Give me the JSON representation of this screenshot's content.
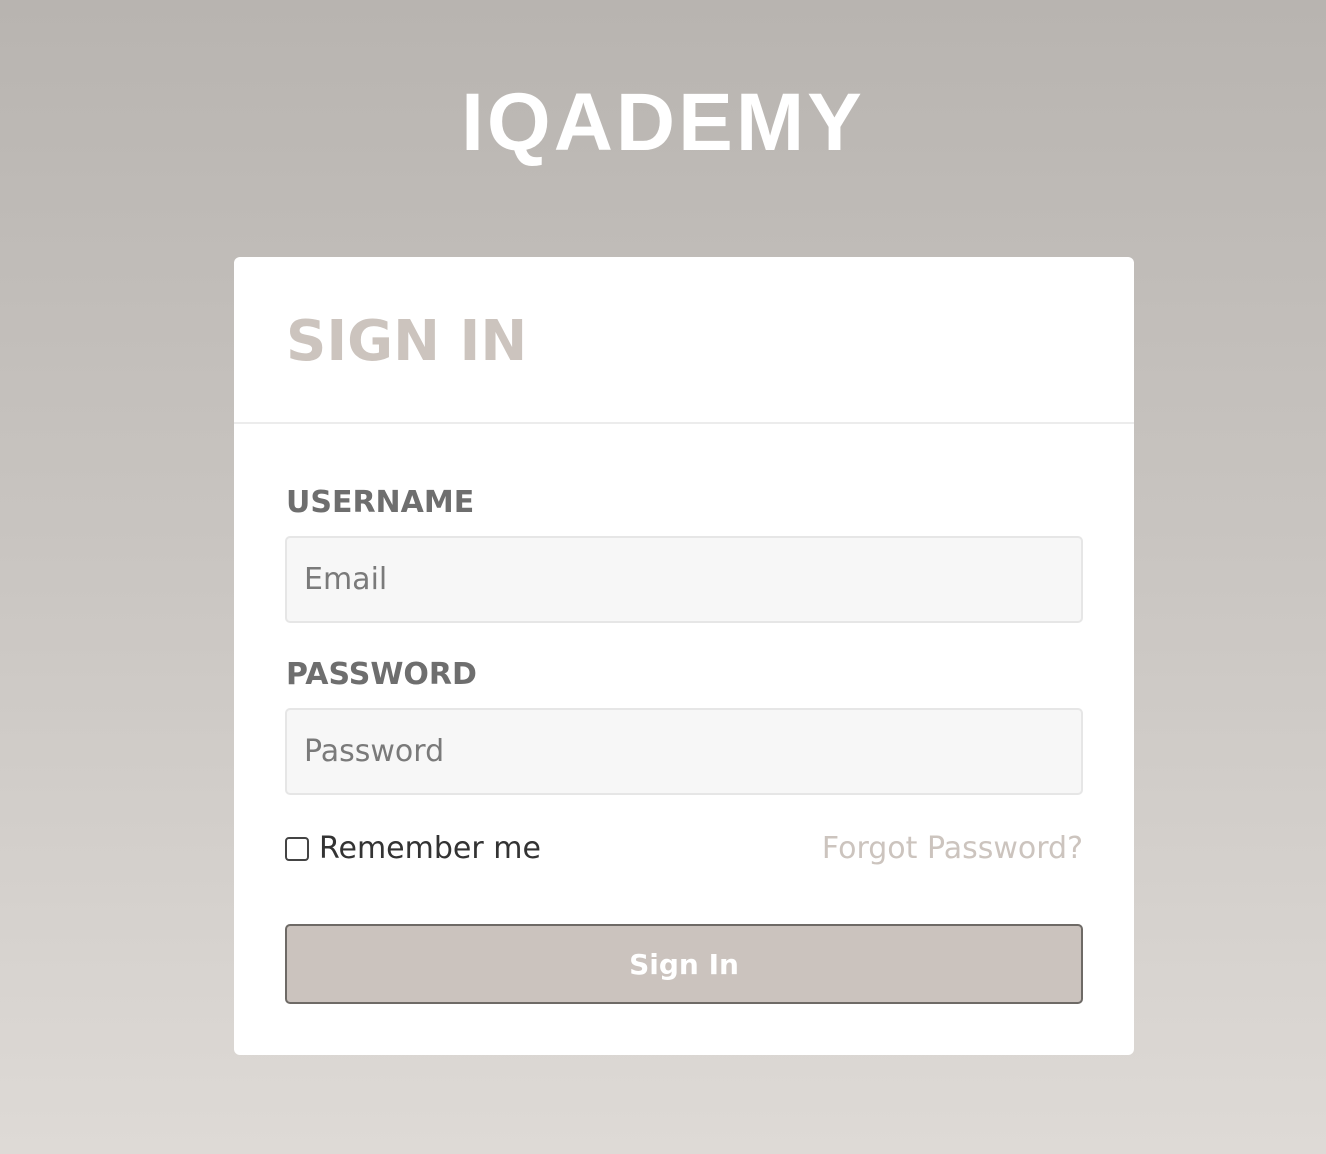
{
  "brand": {
    "logo_text": "IQADEMY"
  },
  "signin_card": {
    "title": "SIGN IN",
    "username_label": "USERNAME",
    "username_placeholder": "Email",
    "username_value": "",
    "password_label": "PASSWORD",
    "password_placeholder": "Password",
    "password_value": "",
    "remember_label": "Remember me",
    "remember_checked": false,
    "forgot_label": "Forgot Password?",
    "submit_label": "Sign In"
  },
  "colors": {
    "background_top": "#b8b4b0",
    "background_bottom": "#dedad6",
    "accent": "#cbc3be",
    "label_text": "#6e6e6e",
    "button_border": "#6e6a66"
  }
}
